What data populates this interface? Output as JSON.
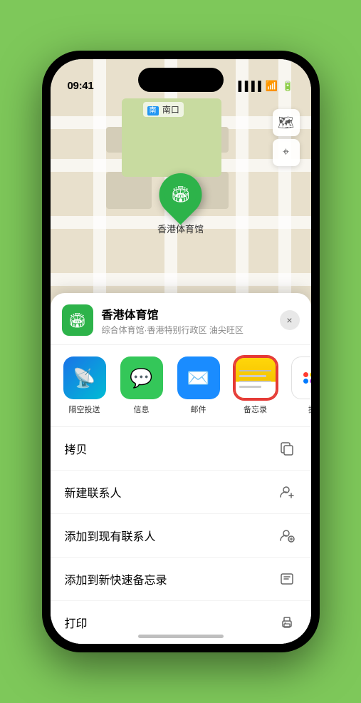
{
  "status_bar": {
    "time": "09:41",
    "location_arrow": "▶"
  },
  "map": {
    "label": "南口",
    "controls": {
      "map_type": "🗺",
      "location": "◎"
    }
  },
  "stadium": {
    "name": "香港体育馆",
    "emoji": "🏟"
  },
  "sheet": {
    "title": "香港体育馆",
    "subtitle": "综合体育馆·香港特别行政区 油尖旺区",
    "close_label": "×"
  },
  "share_items": [
    {
      "id": "airdrop",
      "label": "隔空投送",
      "emoji": "📡"
    },
    {
      "id": "message",
      "label": "信息",
      "emoji": "💬"
    },
    {
      "id": "mail",
      "label": "邮件",
      "emoji": "✉"
    },
    {
      "id": "notes",
      "label": "备忘录",
      "emoji": ""
    },
    {
      "id": "more",
      "label": "提",
      "emoji": ""
    }
  ],
  "actions": [
    {
      "id": "copy",
      "label": "拷贝",
      "icon": "copy"
    },
    {
      "id": "new-contact",
      "label": "新建联系人",
      "icon": "person-plus"
    },
    {
      "id": "add-existing",
      "label": "添加到现有联系人",
      "icon": "person-add"
    },
    {
      "id": "quick-note",
      "label": "添加到新快速备忘录",
      "icon": "quicknote"
    },
    {
      "id": "print",
      "label": "打印",
      "icon": "print"
    }
  ]
}
